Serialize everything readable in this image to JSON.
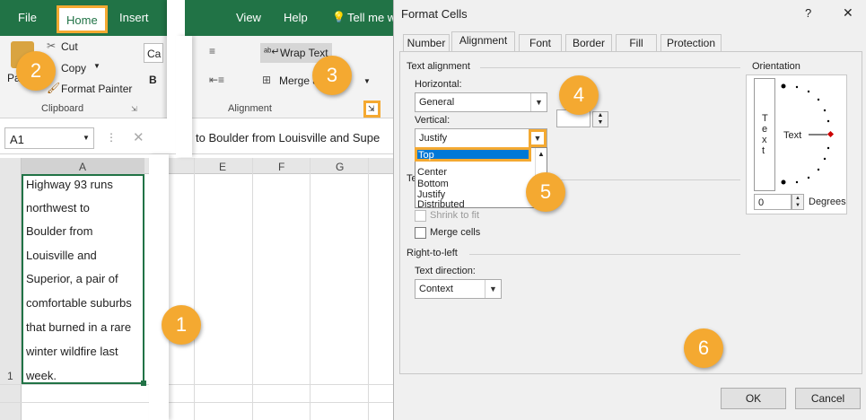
{
  "excel": {
    "tabs": {
      "file": "File",
      "home": "Home",
      "insert": "Insert",
      "view": "View",
      "help": "Help",
      "tell": "Tell me w"
    },
    "clipboard": {
      "cut": "Cut",
      "copy": "Copy",
      "format_painter": "Format Painter",
      "group": "Clipboard",
      "paste_short": "Pa"
    },
    "alignment": {
      "wrap_text": "Wrap Text",
      "merge": "Merge &",
      "group": "Alignment"
    },
    "font_fragment": "Ca",
    "name_box": "A1",
    "formula_text": "to Boulder from Louisville and Supe",
    "columns": [
      "A",
      "E",
      "F",
      "G"
    ],
    "row_number": "1",
    "cell_lines": [
      "Highway 93 runs",
      "northwest to",
      "Boulder from",
      "Louisville and",
      "Superior, a pair of",
      "comfortable suburbs",
      "that burned in a rare",
      "winter wildfire last",
      "week."
    ]
  },
  "badges": [
    "1",
    "2",
    "3",
    "4",
    "5",
    "6"
  ],
  "dialog": {
    "title": "Format Cells",
    "help": "?",
    "close": "✕",
    "tabs": [
      "Number",
      "Alignment",
      "Font",
      "Border",
      "Fill",
      "Protection"
    ],
    "text_alignment": "Text alignment",
    "horizontal_label": "Horizontal:",
    "horizontal_value": "General",
    "vertical_label": "Vertical:",
    "vertical_value": "Justify",
    "vertical_options": [
      "Top",
      "Center",
      "Bottom",
      "Justify",
      "Distributed"
    ],
    "text_control_fragment": "Te",
    "shrink": "Shrink to fit",
    "merge_cells": "Merge cells",
    "rtl": "Right-to-left",
    "text_direction_label": "Text direction:",
    "text_direction_value": "Context",
    "orientation": "Orientation",
    "orientation_text": "Text",
    "degrees_value": "0",
    "degrees_label": "Degrees",
    "ok": "OK",
    "cancel": "Cancel"
  }
}
